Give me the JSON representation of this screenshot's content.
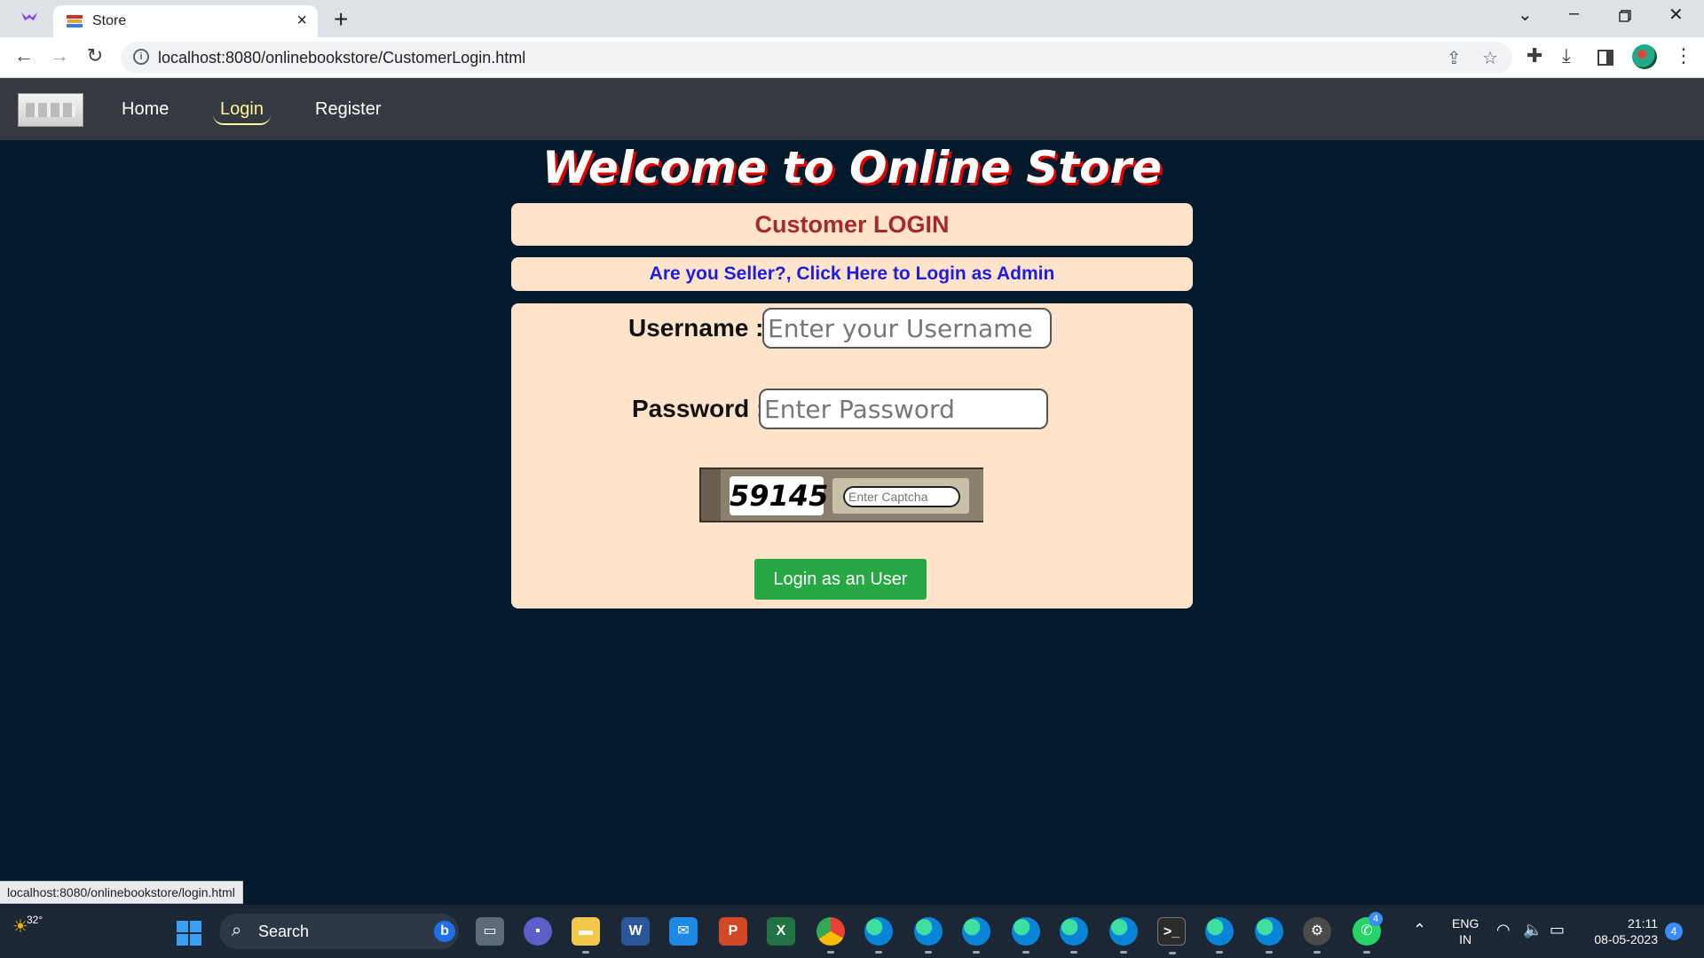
{
  "browser": {
    "tab_title": "Store",
    "url": "localhost:8080/onlinebookstore/CustomerLogin.html",
    "status_url": "localhost:8080/onlinebookstore/login.html"
  },
  "nav": {
    "items": [
      {
        "label": "Home"
      },
      {
        "label": "Login"
      },
      {
        "label": "Register"
      }
    ],
    "active": "Login"
  },
  "page": {
    "title": "Welcome to Online Store",
    "login_heading": "Customer LOGIN",
    "admin_link": "Are you Seller?, Click Here to Login as Admin"
  },
  "form": {
    "username_label": "Username :",
    "username_placeholder": "Enter your Username",
    "password_label": "Password :",
    "password_placeholder": "Enter Password",
    "captcha_code": "59145",
    "captcha_placeholder": "Enter Captcha",
    "submit_label": "Login as an User"
  },
  "taskbar": {
    "weather_temp": "32°",
    "search_label": "Search",
    "whatsapp_badge": "4",
    "lang_top": "ENG",
    "lang_bottom": "IN",
    "time": "21:11",
    "date": "08-05-2023",
    "notification_count": "4"
  },
  "colors": {
    "page_bg": "#03192c",
    "nav_bg": "#343a40",
    "card_bg": "#ffe4cb",
    "heading_color": "#a52a2a",
    "link_color": "#1d1de0",
    "button_color": "#28a745",
    "title_shadow": "#e00000"
  }
}
